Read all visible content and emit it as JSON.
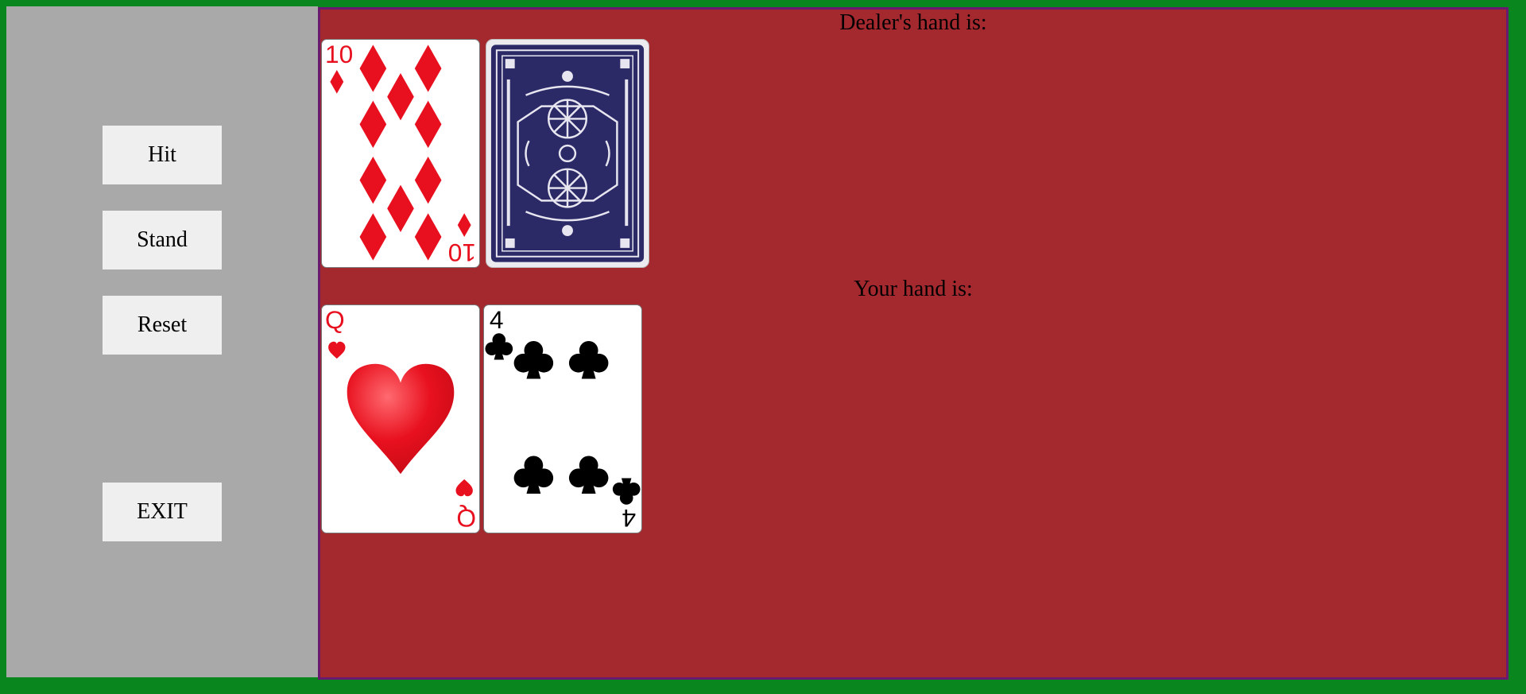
{
  "controls": {
    "hit_label": "Hit",
    "stand_label": "Stand",
    "reset_label": "Reset",
    "exit_label": "EXIT"
  },
  "dealer": {
    "heading": "Dealer's hand is:",
    "cards": [
      {
        "rank": "10",
        "suit": "diamonds",
        "face_up": true
      },
      {
        "face_up": false
      }
    ]
  },
  "player": {
    "heading": "Your hand is:",
    "cards": [
      {
        "rank": "Q",
        "suit": "hearts",
        "face_up": true
      },
      {
        "rank": "4",
        "suit": "clubs",
        "face_up": true
      }
    ]
  },
  "colors": {
    "felt": "#a4292f",
    "frame": "#0a861e",
    "sidebar": "#a9a9aa",
    "card_red": "#e8101e",
    "card_black": "#000000",
    "card_back": "#2b2a67"
  },
  "icons": {
    "diamond": "diamond-suit-icon",
    "heart": "heart-suit-icon",
    "club": "club-suit-icon",
    "card_back": "card-back-pattern"
  }
}
